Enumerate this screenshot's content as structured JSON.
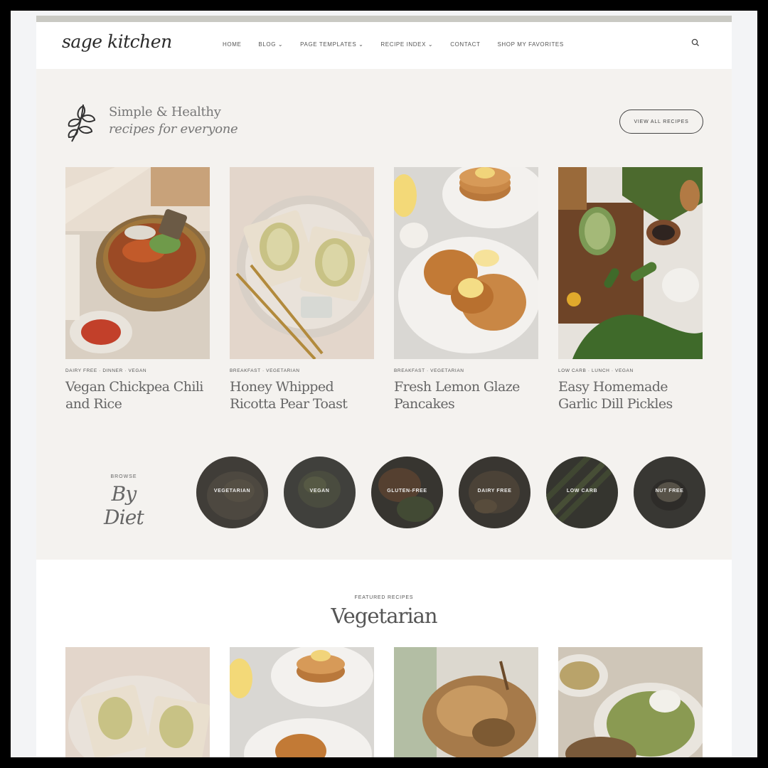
{
  "site": {
    "logo": "sage kitchen"
  },
  "nav": [
    {
      "label": "HOME"
    },
    {
      "label": "BLOG ⌄"
    },
    {
      "label": "PAGE TEMPLATES ⌄"
    },
    {
      "label": "RECIPE INDEX ⌄"
    },
    {
      "label": "CONTACT"
    },
    {
      "label": "SHOP MY FAVORITES"
    }
  ],
  "hero": {
    "line1": "Simple & Healthy",
    "line2": "recipes for everyone",
    "view_all": "VIEW ALL RECIPES"
  },
  "recipes": [
    {
      "tags": "DAIRY FREE · DINNER · VEGAN",
      "title": "Vegan Chickpea Chili and Rice",
      "photo": "chickpea-chili-bowl"
    },
    {
      "tags": "BREAKFAST · VEGETARIAN",
      "title": "Honey Whipped Ricotta Pear Toast",
      "photo": "pear-toast-plate"
    },
    {
      "tags": "BREAKFAST · VEGETARIAN",
      "title": "Fresh Lemon Glaze Pancakes",
      "photo": "lemon-pancakes"
    },
    {
      "tags": "LOW CARB · LUNCH · VEGAN",
      "title": "Easy Homemade Garlic Dill Pickles",
      "photo": "pickles-cutting-board"
    }
  ],
  "browse": {
    "kicker": "BROWSE",
    "title": "By Diet"
  },
  "diets": [
    {
      "label": "VEGETARIAN"
    },
    {
      "label": "VEGAN"
    },
    {
      "label": "GLUTEN-FREE"
    },
    {
      "label": "DAIRY FREE"
    },
    {
      "label": "LOW CARB"
    },
    {
      "label": "NUT FREE"
    }
  ],
  "featured": {
    "kicker": "FEATURED RECIPES",
    "title": "Vegetarian"
  },
  "colors": {
    "hero_bg": "#f4f2ef",
    "text_muted": "#666666",
    "diet_overlay": "#2f2d2a"
  },
  "icons": {
    "search": "search-icon",
    "leaf": "leaf-sprig-icon"
  }
}
